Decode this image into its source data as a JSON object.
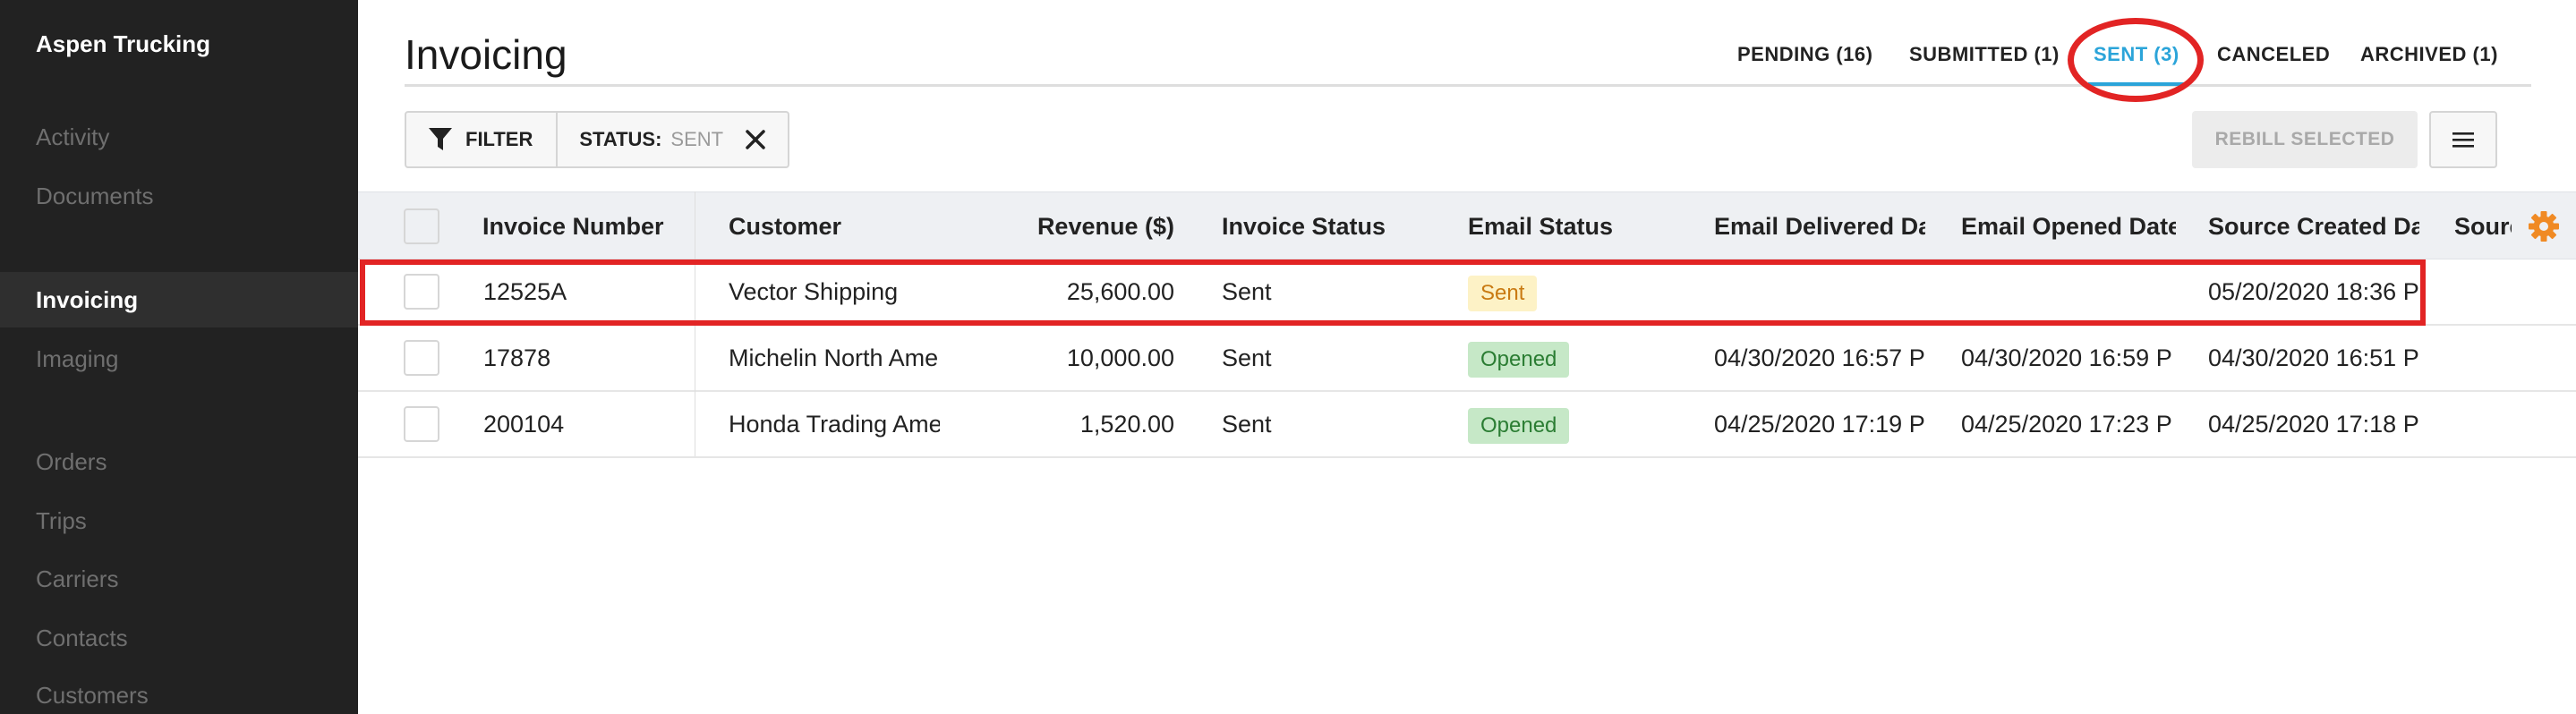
{
  "app": {
    "name": "Aspen Trucking"
  },
  "sidebar": {
    "items": [
      {
        "label": "Activity",
        "active": false
      },
      {
        "label": "Documents",
        "active": false
      },
      {
        "label": "Invoicing",
        "active": true
      },
      {
        "label": "Imaging",
        "active": false
      },
      {
        "label": "Orders",
        "active": false
      },
      {
        "label": "Trips",
        "active": false
      },
      {
        "label": "Carriers",
        "active": false
      },
      {
        "label": "Contacts",
        "active": false
      },
      {
        "label": "Customers",
        "active": false
      }
    ]
  },
  "header": {
    "title": "Invoicing",
    "tabs": [
      {
        "label": "PENDING (16)",
        "active": false
      },
      {
        "label": "SUBMITTED (1)",
        "active": false
      },
      {
        "label": "SENT (3)",
        "active": true
      },
      {
        "label": "CANCELED",
        "active": false
      },
      {
        "label": "ARCHIVED (1)",
        "active": false
      }
    ]
  },
  "toolbar": {
    "filter_label": "FILTER",
    "status_filter": {
      "key": "STATUS:",
      "value": "SENT"
    },
    "rebill_label": "REBILL SELECTED"
  },
  "table": {
    "columns": [
      "Invoice Number",
      "Customer",
      "Revenue ($)",
      "Invoice Status",
      "Email Status",
      "Email Delivered Da",
      "Email Opened Date",
      "Source Created Da",
      "Sourc"
    ],
    "rows": [
      {
        "invoice_number": "12525A",
        "customer": "Vector Shipping",
        "revenue": "25,600.00",
        "invoice_status": "Sent",
        "email_status": "Sent",
        "email_delivered": "",
        "email_opened": "",
        "source_created": "05/20/2020 18:36 P",
        "source": ""
      },
      {
        "invoice_number": "17878",
        "customer": "Michelin North Ame",
        "revenue": "10,000.00",
        "invoice_status": "Sent",
        "email_status": "Opened",
        "email_delivered": "04/30/2020 16:57 P",
        "email_opened": "04/30/2020 16:59 P",
        "source_created": "04/30/2020 16:51 P",
        "source": ""
      },
      {
        "invoice_number": "200104",
        "customer": "Honda Trading Ame",
        "revenue": "1,520.00",
        "invoice_status": "Sent",
        "email_status": "Opened",
        "email_delivered": "04/25/2020 17:19 P",
        "email_opened": "04/25/2020 17:23 P",
        "source_created": "04/25/2020 17:18 P",
        "source": ""
      }
    ]
  },
  "icons": {
    "filter": "filter-icon",
    "close": "close-icon",
    "menu": "hamburger-menu-icon",
    "settings": "gear-icon"
  },
  "colors": {
    "sidebar_bg": "#222222",
    "accent": "#2ba4d9",
    "annotation": "#e22424",
    "badge_sent_bg": "#fdf2c6",
    "badge_sent_text": "#c97a12",
    "badge_opened_bg": "#c6e8c7",
    "badge_opened_text": "#2b7d33",
    "gear": "#f08a24"
  }
}
